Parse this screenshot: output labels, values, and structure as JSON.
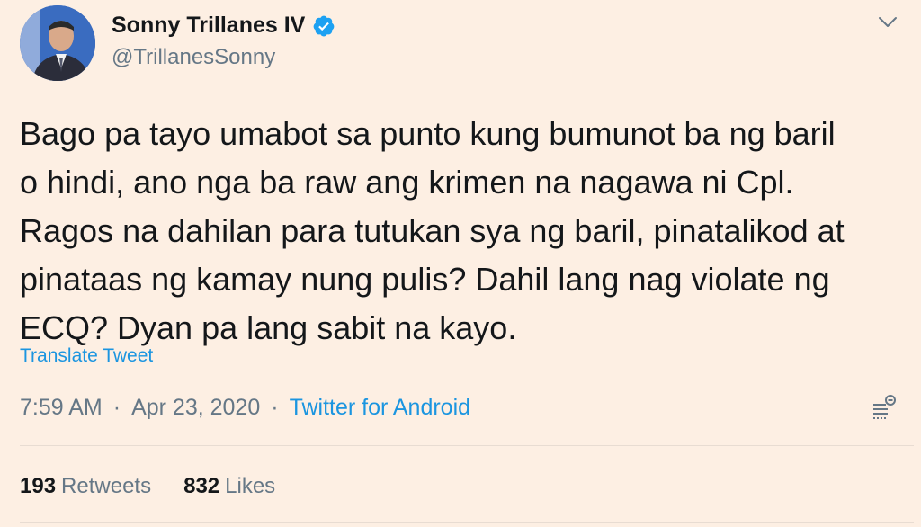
{
  "tweet": {
    "author": {
      "display_name": "Sonny Trillanes IV",
      "handle": "@TrillanesSonny",
      "verified_icon": "verified-badge-icon",
      "avatar_icon": "profile-photo"
    },
    "text": "Bago pa tayo umabot sa punto kung bumunot ba ng baril\no hindi, ano nga ba raw ang krimen na nagawa ni Cpl.\nRagos na dahilan para tutukan sya ng baril, pinatalikod at\npinataas ng kamay nung pulis? Dahil lang nag violate ng\nECQ? Dyan pa lang sabit na kayo.",
    "translate_label": "Translate Tweet",
    "time": "7:59 AM",
    "separator": "·",
    "date": "Apr 23, 2020",
    "source": "Twitter for Android",
    "stats": {
      "retweets_count": "193",
      "retweets_label": "Retweets",
      "likes_count": "832",
      "likes_label": "Likes"
    }
  },
  "colors": {
    "background": "#fdefe3",
    "link": "#1b95e0",
    "secondary_text": "#657786",
    "primary_text": "#14171a"
  }
}
